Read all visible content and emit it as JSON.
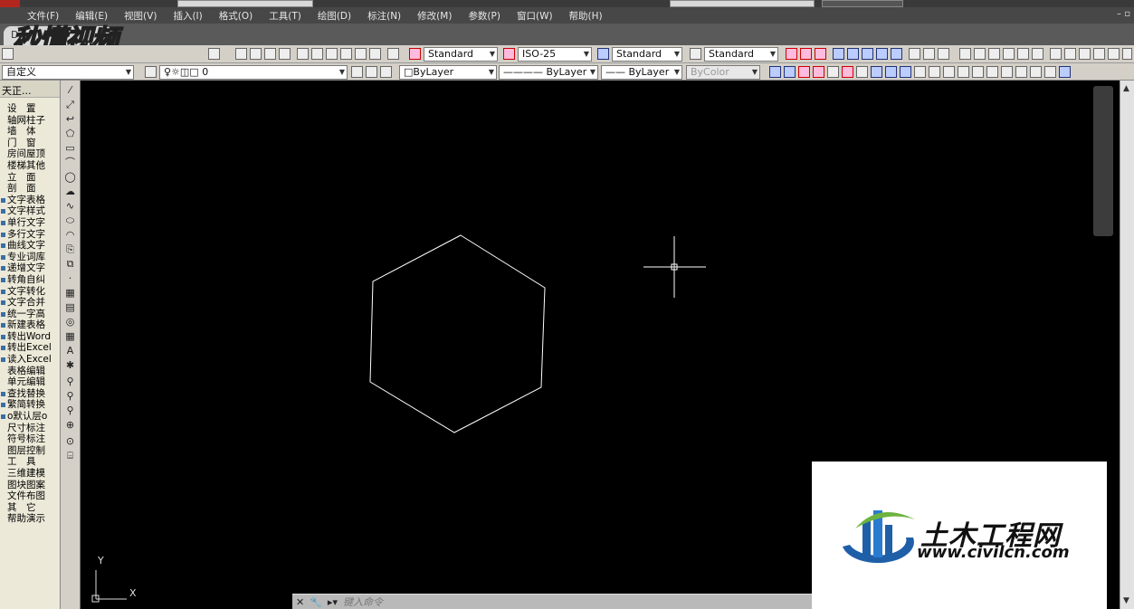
{
  "menu": {
    "items": [
      "文件(F)",
      "编辑(E)",
      "视图(V)",
      "插入(I)",
      "格式(O)",
      "工具(T)",
      "绘图(D)",
      "标注(N)",
      "修改(M)",
      "参数(P)",
      "窗口(W)",
      "帮助(H)"
    ]
  },
  "tab": {
    "label": "Dra"
  },
  "logo_overlay": "秒懂视频",
  "toolbar1": {
    "text_style": "Standard",
    "dim_style": "ISO-25",
    "table_style": "Standard",
    "multileader_style": "Standard"
  },
  "toolbar2": {
    "workspace": "自定义",
    "layer": "0",
    "color": "ByLayer",
    "linetype": "ByLayer",
    "lineweight": "ByLayer",
    "plotstyle": "ByColor"
  },
  "tz_panel": {
    "title": "天正...",
    "items": [
      {
        "label": "设　置",
        "bullet": false
      },
      {
        "label": "轴网柱子",
        "bullet": false
      },
      {
        "label": "墙　体",
        "bullet": false
      },
      {
        "label": "门　窗",
        "bullet": false
      },
      {
        "label": "房间屋顶",
        "bullet": false
      },
      {
        "label": "楼梯其他",
        "bullet": false
      },
      {
        "label": "立　面",
        "bullet": false
      },
      {
        "label": "剖　面",
        "bullet": false
      },
      {
        "label": "文字表格",
        "bullet": true
      },
      {
        "label": "文字样式",
        "bullet": true
      },
      {
        "label": "单行文字",
        "bullet": true
      },
      {
        "label": "多行文字",
        "bullet": true
      },
      {
        "label": "曲线文字",
        "bullet": true
      },
      {
        "label": "专业词库",
        "bullet": true
      },
      {
        "label": "递增文字",
        "bullet": true
      },
      {
        "label": "转角自纠",
        "bullet": true
      },
      {
        "label": "文字转化",
        "bullet": true
      },
      {
        "label": "文字合并",
        "bullet": true
      },
      {
        "label": "统一字高",
        "bullet": true
      },
      {
        "label": "新建表格",
        "bullet": true
      },
      {
        "label": "转出Word",
        "bullet": true
      },
      {
        "label": "转出Excel",
        "bullet": true
      },
      {
        "label": "读入Excel",
        "bullet": true
      },
      {
        "label": "表格编辑",
        "bullet": false
      },
      {
        "label": "单元编辑",
        "bullet": false
      },
      {
        "label": "查找替换",
        "bullet": true
      },
      {
        "label": "繁简转换",
        "bullet": true
      },
      {
        "label": "o默认层o",
        "bullet": true
      },
      {
        "label": "尺寸标注",
        "bullet": false
      },
      {
        "label": "符号标注",
        "bullet": false
      },
      {
        "label": "图层控制",
        "bullet": false
      },
      {
        "label": "工　具",
        "bullet": false
      },
      {
        "label": "三维建模",
        "bullet": false
      },
      {
        "label": "图块图案",
        "bullet": false
      },
      {
        "label": "文件布图",
        "bullet": false
      },
      {
        "label": "其　它",
        "bullet": false
      },
      {
        "label": "帮助演示",
        "bullet": false
      }
    ]
  },
  "ucs": {
    "x_label": "X",
    "y_label": "Y"
  },
  "cmdline": {
    "placeholder": "键入命令"
  },
  "watermark": {
    "name": "土木工程网",
    "url": "www.civilcn.com"
  },
  "colors": {
    "canvas": "#000000",
    "geometry": "#ffffff",
    "menubar": "#474747"
  }
}
